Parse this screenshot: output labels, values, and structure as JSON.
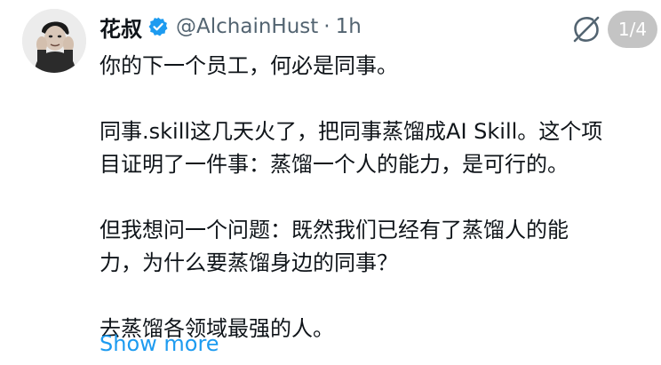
{
  "author": {
    "display_name": "花叔",
    "handle": "@AlchainHust",
    "separator": "·",
    "time": "1h"
  },
  "pager": {
    "label": "1/4"
  },
  "body": {
    "lines": [
      "你的下一个员工，何必是同事。",
      "同事.skill这几天火了，把同事蒸馏成AI Skill。这个项",
      "目证明了一件事：蒸馏一个人的能力，是可行的。",
      "但我想问一个问题：既然我们已经有了蒸馏人的能",
      "力，为什么要蒸馏身边的同事？",
      "去蒸馏各领域最强的人。"
    ]
  },
  "show_more": {
    "label": "Show more"
  },
  "icons": {
    "verified": "verified-badge-icon",
    "grok": "grok-icon"
  },
  "colors": {
    "link": "#1d9bf0",
    "verified": "#1d9bf0",
    "secondary_text": "#536471"
  }
}
